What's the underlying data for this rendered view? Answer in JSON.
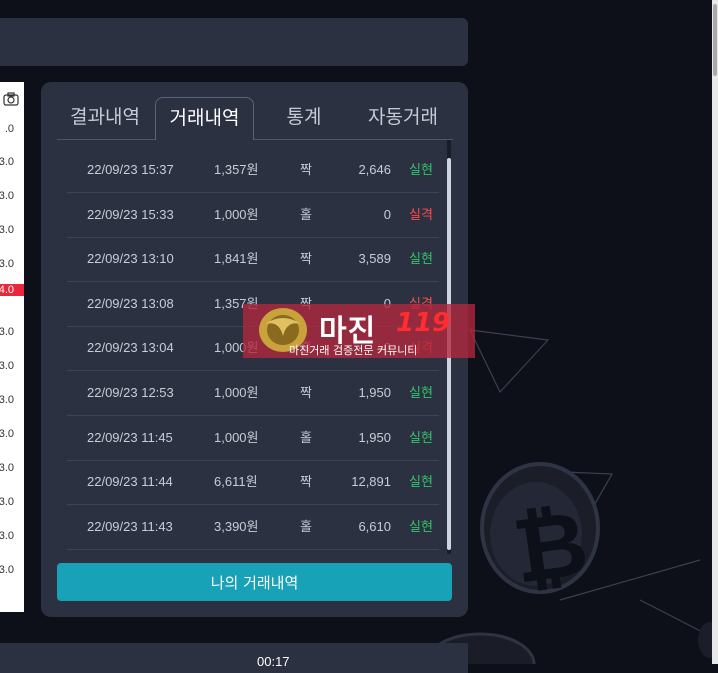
{
  "chart_axis": [
    "0",
    "0",
    "0",
    "0",
    "0",
    "0",
    "0",
    "0",
    "0",
    "0",
    "0",
    "0",
    "0",
    "0"
  ],
  "chart_axis_prefix": [
    ".0",
    "3.0",
    "3.0",
    "3.0",
    "3.0",
    "4.0",
    "3.0",
    "3.0",
    "3.0",
    "3.0",
    "3.0",
    "3.0",
    "3.0",
    "3.0"
  ],
  "tabs": [
    {
      "label": "결과내역",
      "active": false
    },
    {
      "label": "거래내역",
      "active": true
    },
    {
      "label": "통계",
      "active": false
    },
    {
      "label": "자동거래",
      "active": false
    }
  ],
  "rows": [
    {
      "date": "22/09/23 15:37",
      "amount": "1,357원",
      "pick": "짝",
      "payout": "2,646",
      "result": "실현",
      "status": "win"
    },
    {
      "date": "22/09/23 15:33",
      "amount": "1,000원",
      "pick": "홀",
      "payout": "0",
      "result": "실격",
      "status": "lose"
    },
    {
      "date": "22/09/23 13:10",
      "amount": "1,841원",
      "pick": "짝",
      "payout": "3,589",
      "result": "실현",
      "status": "win"
    },
    {
      "date": "22/09/23 13:08",
      "amount": "1,357원",
      "pick": "짝",
      "payout": "0",
      "result": "실격",
      "status": "lose"
    },
    {
      "date": "22/09/23 13:04",
      "amount": "1,000원",
      "pick": "홀",
      "payout": "0",
      "result": "실격",
      "status": "lose"
    },
    {
      "date": "22/09/23 12:53",
      "amount": "1,000원",
      "pick": "짝",
      "payout": "1,950",
      "result": "실현",
      "status": "win"
    },
    {
      "date": "22/09/23 11:45",
      "amount": "1,000원",
      "pick": "홀",
      "payout": "1,950",
      "result": "실현",
      "status": "win"
    },
    {
      "date": "22/09/23 11:44",
      "amount": "6,611원",
      "pick": "짝",
      "payout": "12,891",
      "result": "실현",
      "status": "win"
    },
    {
      "date": "22/09/23 11:43",
      "amount": "3,390원",
      "pick": "홀",
      "payout": "6,610",
      "result": "실현",
      "status": "win"
    }
  ],
  "my_history_button": "나의 거래내역",
  "timer": "00:17",
  "watermark": {
    "title": "마진",
    "number": "119",
    "subtitle": "마진거래 검증전문 커뮤니티"
  },
  "colors": {
    "win": "#33c46a",
    "lose": "#ff4a4a",
    "button": "#17a2b8",
    "panel": "#2c3142"
  },
  "icons": [
    "camera-icon",
    "bitcoin-coin-icon"
  ]
}
